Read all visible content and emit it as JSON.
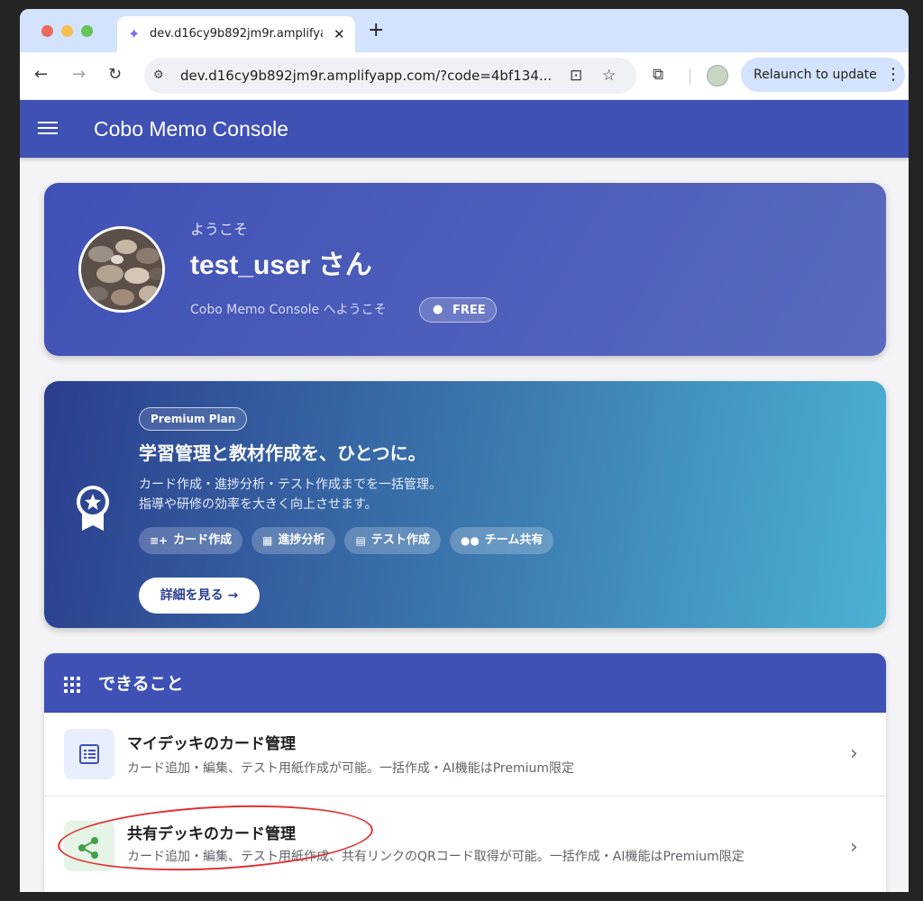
{
  "browser": {
    "tab_title": "dev.d16cy9b892jm9r.amplifyapp.com",
    "tab_favicon": "sparkle-icon",
    "url": "dev.d16cy9b892jm9r.amplifyapp.com/?code=4bf134...",
    "relaunch_label": "Relaunch to update"
  },
  "appbar": {
    "title": "Cobo Memo Console"
  },
  "welcome": {
    "greeting": "ようこそ",
    "username": "test_user さん",
    "subtitle": "Cobo Memo Console へようこそ",
    "plan_badge": "FREE"
  },
  "premium": {
    "badge": "Premium Plan",
    "headline": "学習管理と教材作成を、ひとつに。",
    "desc_line1": "カード作成・進捗分析・テスト作成までを一括管理。",
    "desc_line2": "指導や研修の効率を大きく向上させます。",
    "chips": [
      {
        "label": "カード作成",
        "icon": "playlist-add-icon"
      },
      {
        "label": "進捗分析",
        "icon": "bar-chart-icon"
      },
      {
        "label": "テスト作成",
        "icon": "clipboard-icon"
      },
      {
        "label": "チーム共有",
        "icon": "group-icon"
      }
    ],
    "details_button": "詳細を見る →"
  },
  "capabilities": {
    "title": "できること",
    "items": [
      {
        "title": "マイデッキのカード管理",
        "desc": "カード追加・編集、テスト用紙作成が可能。一括作成・AI機能はPremium限定",
        "icon": "list-alt-icon"
      },
      {
        "title": "共有デッキのカード管理",
        "desc": "カード追加・編集、テスト用紙作成、共有リンクのQRコード取得が可能。一括作成・AI機能はPremium限定",
        "icon": "share-icon"
      }
    ]
  },
  "colors": {
    "primary": "#3f51b5",
    "annotation": "#e03131"
  }
}
